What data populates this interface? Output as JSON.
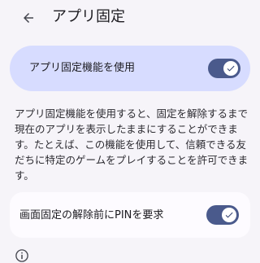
{
  "header": {
    "back_icon": "arrow-left-icon",
    "title": "アプリ固定"
  },
  "main_toggle": {
    "label": "アプリ固定機能を使用",
    "checked": true
  },
  "description": "アプリ固定機能を使用すると、固定を解除するまで現在のアプリを表示したままにすることができます。たとえば、この機能を使用して、信頼できる友だちに特定のゲームをプレイすることを許可できます。",
  "pin_toggle": {
    "label": "画面固定の解除前にPINを要求",
    "checked": true
  },
  "footer": {
    "icon": "info-icon"
  },
  "colors": {
    "background": "#f6f4f9",
    "main_card": "#d7dcff",
    "switch_track": "#4a5a8c",
    "pin_card": "#fdfbff"
  }
}
